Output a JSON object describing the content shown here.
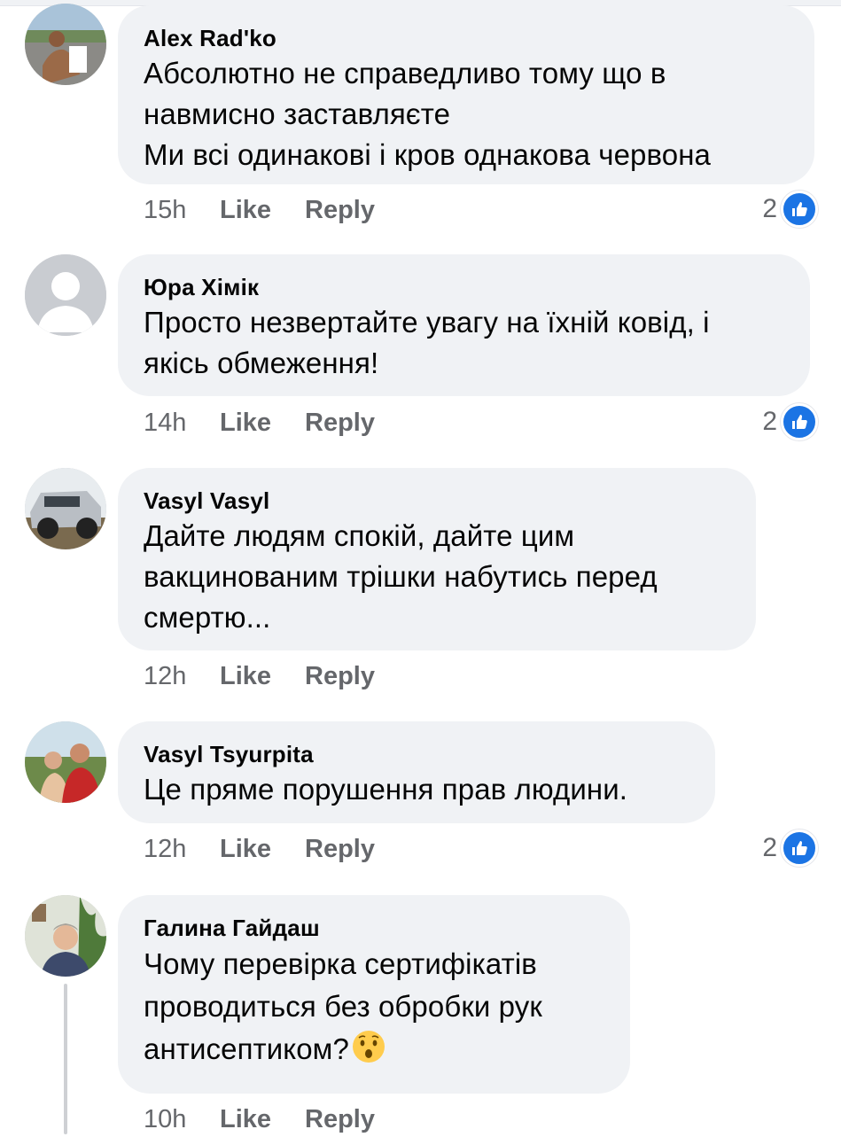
{
  "colors": {
    "bubble": "#f0f2f5",
    "meta_text": "#65676b",
    "like_blue": "#1b74e4",
    "avatar_default": "#bcc0c4"
  },
  "comments": [
    {
      "author": "Alex Rad'ko",
      "text": "Абсолютно не справедливо тому що в\nнавмисно заставляєте\nМи всі одинакові і кров однакова червона",
      "time": "15h",
      "like_label": "Like",
      "reply_label": "Reply",
      "reactions": "2",
      "reaction_icon": "thumbs-up-icon",
      "avatar": "photo-man-at-beach"
    },
    {
      "author": "Юра Хімік",
      "text": "Просто незвертайте увагу на їхній ковід, і\nякісь обмеження!",
      "time": "14h",
      "like_label": "Like",
      "reply_label": "Reply",
      "reactions": "2",
      "reaction_icon": "thumbs-up-icon",
      "avatar": "default-silhouette"
    },
    {
      "author": "Vasyl Vasyl",
      "text": "Дайте людям спокій, дайте цим\nвакцинованим трішки набутись перед\nсмертю...",
      "time": "12h",
      "like_label": "Like",
      "reply_label": "Reply",
      "avatar": "photo-silver-suv"
    },
    {
      "author": "Vasyl Tsyurpita",
      "text": "Це пряме порушення прав людини.",
      "time": "12h",
      "like_label": "Like",
      "reply_label": "Reply",
      "reactions": "2",
      "reaction_icon": "thumbs-up-icon",
      "avatar": "photo-couple-outdoors"
    },
    {
      "author": "Галина Гайдаш",
      "text": "Чому перевірка сертифікатів\nпроводиться без обробки рук\nантисептиком?",
      "emoji": "hushed-face-emoji",
      "time": "10h",
      "like_label": "Like",
      "reply_label": "Reply",
      "avatar": "photo-woman-with-plants"
    }
  ]
}
